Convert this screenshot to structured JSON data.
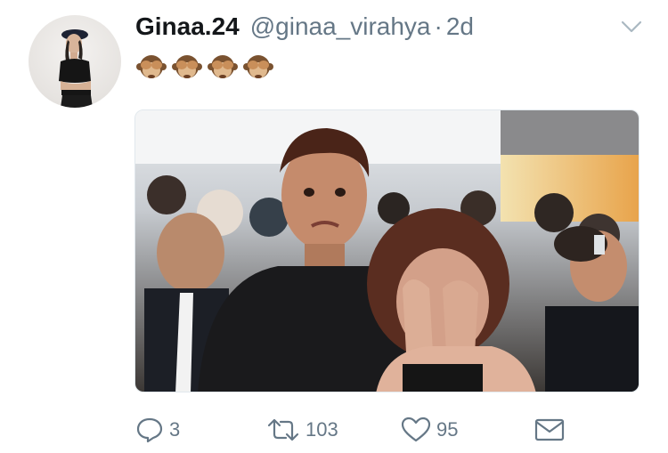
{
  "tweet": {
    "author": {
      "display_name": "Ginaa.24",
      "handle": "@ginaa_virahya",
      "separator": "·",
      "time": "2d",
      "avatar_icon": "profile-photo"
    },
    "text_emoji": [
      "see-no-evil-monkey",
      "see-no-evil-monkey",
      "see-no-evil-monkey",
      "see-no-evil-monkey"
    ],
    "media": {
      "type": "photo",
      "description_icon": "photo"
    },
    "actions": {
      "reply_count": "3",
      "retweet_count": "103",
      "like_count": "95"
    }
  },
  "colors": {
    "text_primary": "#14171a",
    "text_secondary": "#657786",
    "border": "#e1e8ed"
  }
}
